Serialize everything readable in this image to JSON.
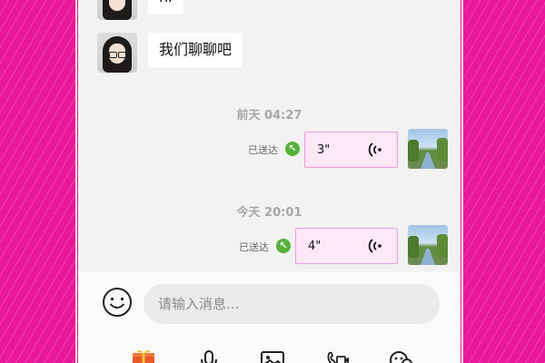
{
  "chat": {
    "messages_in": [
      {
        "text": "hi"
      },
      {
        "text": "我们聊聊吧"
      }
    ],
    "groups": [
      {
        "time": "前天 04:27",
        "status": "已送达",
        "duration": "3\""
      },
      {
        "time": "今天 20:01",
        "status": "已送达",
        "duration": "4\""
      }
    ]
  },
  "composer": {
    "placeholder": "请输入消息..."
  },
  "toolbar": {
    "icons": [
      "gift-icon",
      "microphone-icon",
      "image-icon",
      "video-call-icon",
      "game-icon"
    ]
  },
  "colors": {
    "background": "#e8189a",
    "voice_bubble": "#fce8f6",
    "voice_border": "#ef9ad6",
    "sent_check": "#55b139"
  }
}
